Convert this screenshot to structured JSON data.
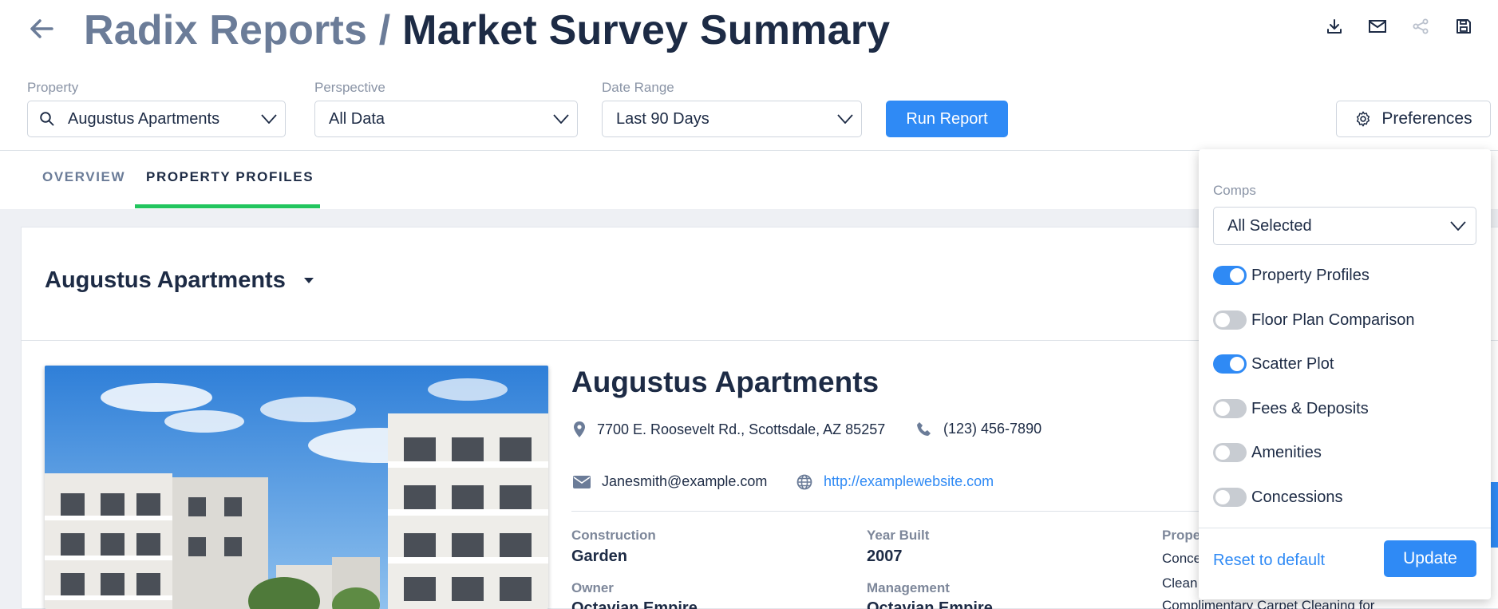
{
  "header": {
    "breadcrumb": "Radix Reports",
    "separator": "/",
    "page_title": "Market Survey Summary",
    "icons": [
      "arrow-left-icon",
      "download-icon",
      "mail-icon",
      "share-icon",
      "save-icon"
    ]
  },
  "filters": {
    "property": {
      "label": "Property",
      "value": "Augustus Apartments",
      "icon": "search-icon"
    },
    "perspective": {
      "label": "Perspective",
      "value": "All Data"
    },
    "date_range": {
      "label": "Date Range",
      "value": "Last 90 Days"
    },
    "run_label": "Run Report",
    "preferences_label": "Preferences"
  },
  "tabs": [
    {
      "label": "OVERVIEW",
      "active": false
    },
    {
      "label": "PROPERTY PROFILES",
      "active": true
    }
  ],
  "card": {
    "selector_title": "Augustus Apartments",
    "property": {
      "name": "Augustus Apartments",
      "address": "7700 E. Roosevelt Rd., Scottsdale, AZ 85257",
      "phone": "(123) 456-7890",
      "email": "Janesmith@example.com",
      "website": "http://examplewebsite.com"
    },
    "meta": {
      "construction_label": "Construction",
      "construction_value": "Garden",
      "year_built_label": "Year Built",
      "year_built_value": "2007",
      "owner_label": "Owner",
      "owner_value": "Octavian Empire",
      "management_label": "Management",
      "management_value": "Octavian Empire",
      "third_label": "Prope",
      "third_lines": [
        "Conce",
        "Clean",
        "Complimentary Carpet Cleaning for"
      ]
    }
  },
  "preferences_panel": {
    "comps_label": "Comps",
    "comps_value": "All Selected",
    "toggles": [
      {
        "label": "Property Profiles",
        "on": true
      },
      {
        "label": "Floor Plan Comparison",
        "on": false
      },
      {
        "label": "Scatter Plot",
        "on": true
      },
      {
        "label": "Fees & Deposits",
        "on": false
      },
      {
        "label": "Amenities",
        "on": false
      },
      {
        "label": "Concessions",
        "on": false
      }
    ],
    "reset_label": "Reset to default",
    "update_label": "Update"
  },
  "colors": {
    "accent": "#2f8af5",
    "tab_underline": "#22c55e",
    "title_dark": "#1d2b45",
    "title_muted": "#6b7c98"
  }
}
